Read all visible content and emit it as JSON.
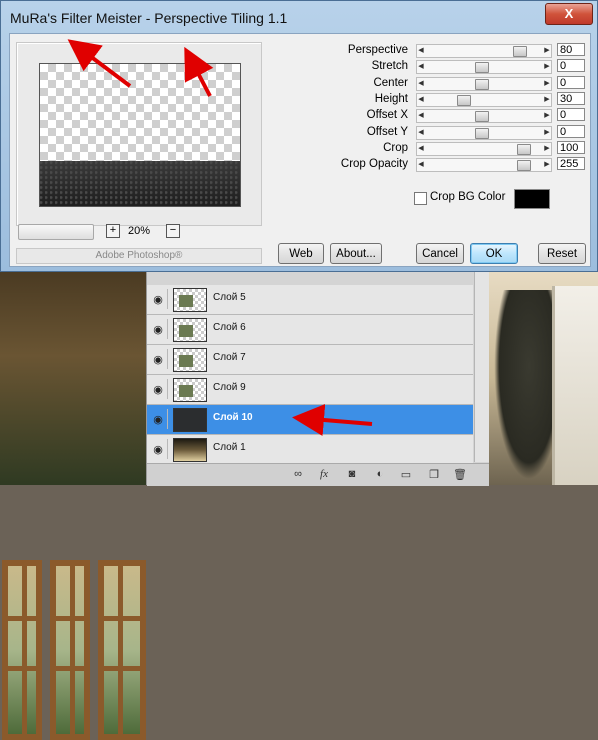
{
  "dialog": {
    "title": "MuRa's Filter Meister - Perspective Tiling 1.1",
    "close_label": "X"
  },
  "preview": {
    "zoom_value": "20%",
    "zoom_plus": "+",
    "zoom_minus": "−",
    "host_label": "Adobe Photoshop®"
  },
  "params": [
    {
      "label": "Perspective",
      "value": "80"
    },
    {
      "label": "Stretch",
      "value": "0"
    },
    {
      "label": "Center",
      "value": "0"
    },
    {
      "label": "Height",
      "value": "30"
    },
    {
      "label": "Offset X",
      "value": "0"
    },
    {
      "label": "Offset Y",
      "value": "0"
    },
    {
      "label": "Crop",
      "value": "100"
    },
    {
      "label": "Crop Opacity",
      "value": "255"
    }
  ],
  "crop_bg": {
    "label": "Crop BG Color",
    "checked": false,
    "color": "#000000"
  },
  "buttons": {
    "web": "Web",
    "about": "About...",
    "cancel": "Cancel",
    "ok": "OK",
    "reset": "Reset"
  },
  "layers": {
    "items": [
      {
        "name": "Слой 5",
        "visible": true,
        "active": false
      },
      {
        "name": "Слой 6",
        "visible": true,
        "active": false
      },
      {
        "name": "Слой 7",
        "visible": true,
        "active": false
      },
      {
        "name": "Слой 9",
        "visible": true,
        "active": false
      },
      {
        "name": "Слой 10",
        "visible": true,
        "active": true
      },
      {
        "name": "Слой 1",
        "visible": true,
        "active": false
      }
    ],
    "toolbar_icons": [
      "link-icon",
      "fx-icon",
      "mask-icon",
      "adjustment-icon",
      "group-folder-icon",
      "new-layer-icon",
      "trash-icon"
    ]
  },
  "colors": {
    "active_layer": "#3d8fe6",
    "annotation_arrow": "#e00000",
    "titlebar": "#b8d2ea"
  }
}
